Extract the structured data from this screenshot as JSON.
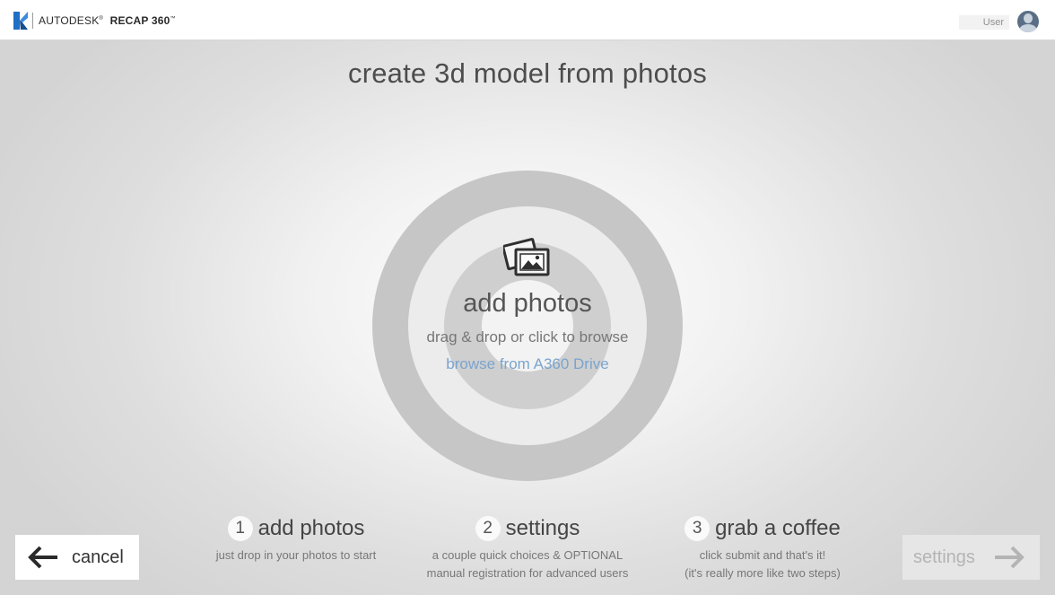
{
  "header": {
    "brand_prefix": "AUTODESK",
    "brand_product": "RECAP 360",
    "user_label": "User"
  },
  "main": {
    "title": "create 3d model from photos",
    "dropzone": {
      "icon": "photos-icon",
      "label": "add photos",
      "hint": "drag & drop or click to browse",
      "browse_link": "browse from A360 Drive"
    }
  },
  "steps": [
    {
      "number": "1",
      "title": "add photos",
      "desc": [
        "just drop in your photos to start"
      ]
    },
    {
      "number": "2",
      "title": "settings",
      "desc": [
        "a couple quick choices & OPTIONAL",
        "manual registration for advanced users"
      ]
    },
    {
      "number": "3",
      "title": "grab a coffee",
      "desc": [
        "click submit and that's it!",
        "(it's really more like two steps)"
      ]
    }
  ],
  "footer": {
    "cancel_label": "cancel",
    "next_label": "settings",
    "next_enabled": false
  },
  "colors": {
    "link": "#7aa4cf",
    "logo_blue": "#1f6fc5"
  }
}
